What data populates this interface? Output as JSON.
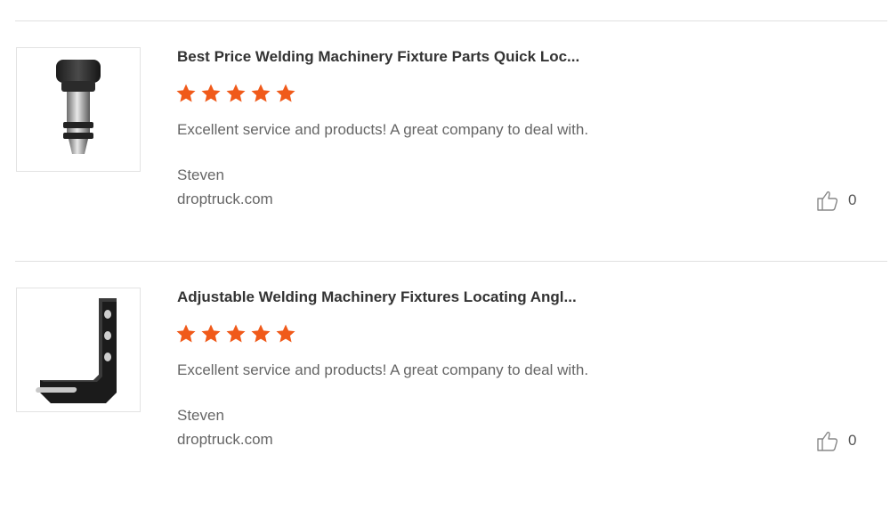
{
  "reviews": [
    {
      "product_title": "Best Price Welding Machinery Fixture Parts Quick Loc...",
      "product_image": "quick-lock-pin-image",
      "rating": 5,
      "comment": "Excellent service and products! A great company to deal with.",
      "author": "Steven",
      "site": "droptruck.com",
      "likes": "0"
    },
    {
      "product_title": "Adjustable Welding Machinery Fixtures Locating Angl...",
      "product_image": "angle-bracket-image",
      "rating": 5,
      "comment": "Excellent service and products! A great company to deal with.",
      "author": "Steven",
      "site": "droptruck.com",
      "likes": "0"
    }
  ],
  "colors": {
    "star": "#f05a1a",
    "divider": "#e0e0e0",
    "text_muted": "#666666"
  },
  "icons": {
    "star": "star-icon",
    "like": "thumbs-up-icon"
  }
}
